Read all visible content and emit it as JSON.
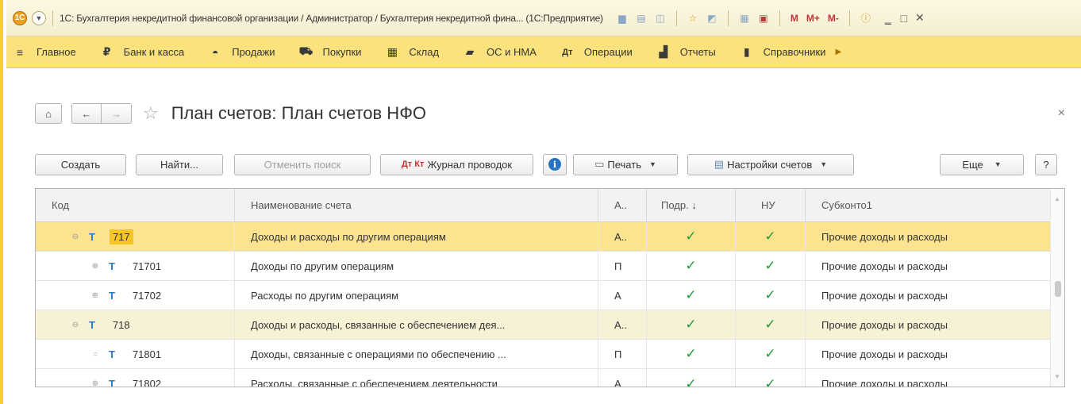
{
  "window": {
    "title": "1С: Бухгалтерия некредитной финансовой организации / Администратор / Бухгалтерия некредитной фина...  (1С:Предприятие)",
    "tools": {
      "m": "M",
      "mplus": "M+",
      "mminus": "M-"
    }
  },
  "menu": {
    "items": [
      {
        "label": "Главное",
        "icon": "hamburger-icon"
      },
      {
        "label": "Банк и касса",
        "icon": "ruble-icon"
      },
      {
        "label": "Продажи",
        "icon": "shopping-bag-icon"
      },
      {
        "label": "Покупки",
        "icon": "cart-icon"
      },
      {
        "label": "Склад",
        "icon": "warehouse-icon"
      },
      {
        "label": "ОС и НМА",
        "icon": "truck-icon"
      },
      {
        "label": "Операции",
        "icon": "operations-icon"
      },
      {
        "label": "Отчеты",
        "icon": "chart-icon"
      },
      {
        "label": "Справочники",
        "icon": "book-icon"
      }
    ]
  },
  "page": {
    "title": "План счетов: План счетов НФО"
  },
  "toolbar": {
    "create": "Создать",
    "find": "Найти...",
    "cancel_search": "Отменить поиск",
    "journal": "Журнал проводок",
    "journal_icon_text": "Дт Кт",
    "print": "Печать",
    "account_settings": "Настройки счетов",
    "more": "Еще",
    "help": "?"
  },
  "table": {
    "columns": {
      "code": "Код",
      "name": "Наименование счета",
      "a": "А..",
      "podr": "Подр.  ↓",
      "nu": "НУ",
      "sub1": "Субконто1"
    },
    "rows": [
      {
        "toggle": "⊖",
        "type": "Т",
        "code": "717",
        "name": "Доходы и расходы по другим операциям",
        "a": "А..",
        "podr": "✓",
        "nu": "✓",
        "sub1": "Прочие доходы и расходы"
      },
      {
        "toggle": "⊕",
        "type": "Т",
        "code": "71701",
        "name": "Доходы по другим операциям",
        "a": "П",
        "podr": "✓",
        "nu": "✓",
        "sub1": "Прочие доходы и расходы"
      },
      {
        "toggle": "⊕",
        "type": "Т",
        "code": "71702",
        "name": "Расходы по другим операциям",
        "a": "А",
        "podr": "✓",
        "nu": "✓",
        "sub1": "Прочие доходы и расходы"
      },
      {
        "toggle": "⊖",
        "type": "Т",
        "code": "718",
        "name": "Доходы и расходы, связанные с обеспечением дея...",
        "a": "А..",
        "podr": "✓",
        "nu": "✓",
        "sub1": "Прочие доходы и расходы"
      },
      {
        "toggle": "○",
        "type": "Т",
        "code": "71801",
        "name": "Доходы, связанные с операциями по обеспечению ...",
        "a": "П",
        "podr": "✓",
        "nu": "✓",
        "sub1": "Прочие доходы и расходы"
      },
      {
        "toggle": "⊕",
        "type": "Т",
        "code": "71802",
        "name": "Расходы, связанные с обеспечением деятельности",
        "a": "А",
        "podr": "✓",
        "nu": "✓",
        "sub1": "Прочие доходы и расходы"
      }
    ]
  },
  "colors": {
    "accent_yellow": "#fbe27d",
    "selected_row": "#fbe390",
    "check_green": "#1f9a34",
    "type_blue": "#2a79c4"
  }
}
